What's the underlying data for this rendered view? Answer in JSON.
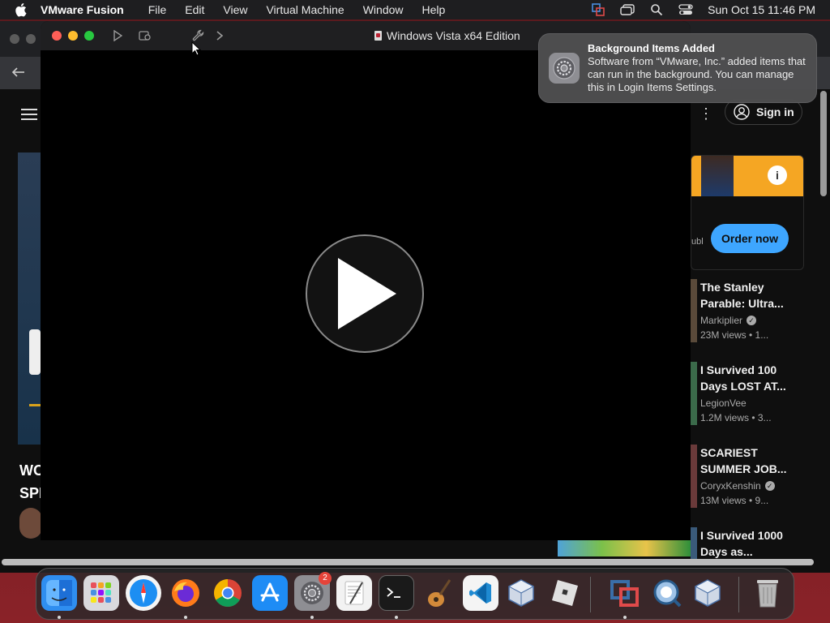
{
  "menubar": {
    "app_name": "VMware Fusion",
    "items": [
      "File",
      "Edit",
      "View",
      "Virtual Machine",
      "Window",
      "Help"
    ],
    "clock": "Sun Oct 15  11:46 PM"
  },
  "vm_window": {
    "title": "Windows Vista x64 Edition"
  },
  "notification": {
    "title": "Background Items Added",
    "body": "Software from “VMware, Inc.” added items that can run in the background. You can manage this in Login Items Settings."
  },
  "youtube": {
    "sign_in_label": "Sign in",
    "ad": {
      "cta_label": "Order now",
      "info_glyph": "i",
      "sub_fragment": "ubl"
    },
    "left_title_line1": "WO",
    "left_title_line2": "SPI",
    "videos": [
      {
        "title": "The Stanley Parable: Ultra...",
        "channel": "Markiplier",
        "verified": true,
        "meta": "23M views  • 1...",
        "thumb_color": "#5a4a3a"
      },
      {
        "title": "I Survived 100 Days LOST AT...",
        "channel": "LegionVee",
        "verified": false,
        "meta": "1.2M views  • 3...",
        "thumb_color": "#3b6a4a"
      },
      {
        "title": "SCARIEST SUMMER JOB...",
        "channel": "CoryxKenshin",
        "verified": true,
        "meta": "13M views  • 9...",
        "thumb_color": "#6a3a3a"
      },
      {
        "title": "I Survived 1000 Days as...",
        "channel": "",
        "verified": false,
        "meta": "",
        "thumb_color": "#3a5a7a"
      }
    ]
  },
  "dock": {
    "items": [
      {
        "name": "finder",
        "color": "#2f8ef0",
        "running": true
      },
      {
        "name": "launchpad",
        "color": "#d9d9dd",
        "running": false
      },
      {
        "name": "safari",
        "color": "#1c8ef2",
        "running": false
      },
      {
        "name": "firefox",
        "color": "#ff7b1a",
        "running": true
      },
      {
        "name": "chrome",
        "color": "#e8e8e8",
        "running": false
      },
      {
        "name": "app-store",
        "color": "#1e8cf5",
        "running": false
      },
      {
        "name": "system-settings",
        "color": "#8e8e93",
        "running": true,
        "badge": "2"
      },
      {
        "name": "textedit",
        "color": "#f2f2f2",
        "running": false
      },
      {
        "name": "terminal",
        "color": "#1a1a1a",
        "running": true
      },
      {
        "name": "garageband",
        "color": "#3a3a3a",
        "running": false
      },
      {
        "name": "vscode",
        "color": "#f4f4f4",
        "running": false
      },
      {
        "name": "virtualbox",
        "color": "#cfd8e6",
        "running": false
      },
      {
        "name": "roblox",
        "color": "#d6d6d6",
        "running": false
      },
      {
        "name": "vmware-fusion",
        "color": "#3a6ea8",
        "running": true
      },
      {
        "name": "quicktime",
        "color": "#9fc3e8",
        "running": false
      },
      {
        "name": "virtualbox-vm",
        "color": "#cfd8e6",
        "running": false
      },
      {
        "name": "trash",
        "color": "#9a9a9a",
        "running": false
      }
    ]
  }
}
